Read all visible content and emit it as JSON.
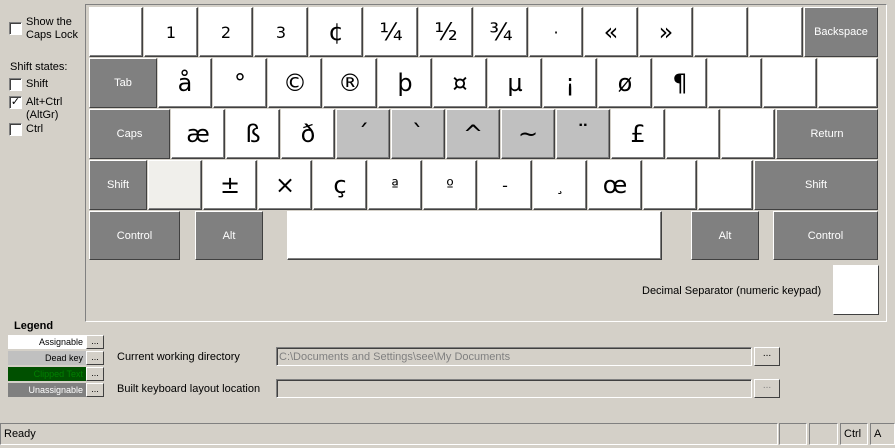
{
  "options": {
    "show_caps_lock": {
      "label": "Show the Caps Lock",
      "checked": false
    },
    "shift_states_title": "Shift states:",
    "shift": {
      "label": "Shift",
      "checked": false
    },
    "altgr": {
      "label": "Alt+Ctrl (AltGr)",
      "checked": true
    },
    "ctrl": {
      "label": "Ctrl",
      "checked": false
    }
  },
  "keyboard": {
    "row1": [
      "",
      "1",
      "2",
      "3",
      "¢",
      "¼",
      "½",
      "¾",
      "·",
      "«",
      "»",
      "",
      "",
      "Backspace"
    ],
    "row2": [
      "Tab",
      "å",
      "°",
      "©",
      "®",
      "þ",
      "¤",
      "µ",
      "¡",
      "ø",
      "¶",
      "",
      "",
      ""
    ],
    "row3": [
      "Caps",
      "æ",
      "ß",
      "ð",
      "´",
      "`",
      "^",
      "~",
      "¨",
      "£",
      "",
      "",
      "Return"
    ],
    "row4": [
      "Shift",
      "",
      "±",
      "×",
      "ç",
      "ª",
      "º",
      "-",
      "¸",
      "œ",
      "",
      "",
      "Shift"
    ],
    "row5": [
      "Control",
      "Alt",
      "",
      "Alt",
      "Control"
    ],
    "decimal_separator_label": "Decimal Separator (numeric keypad)",
    "decimal_separator_value": ""
  },
  "legend": {
    "title": "Legend",
    "items": [
      {
        "label": "Assignable",
        "color": "#ffffff",
        "text_color": "#000000"
      },
      {
        "label": "Dead key",
        "color": "#c0c0c0",
        "text_color": "#000000"
      },
      {
        "label": "Clipped Text",
        "color": "#005000",
        "text_color": "#008000"
      },
      {
        "label": "Unassignable",
        "color": "#808080",
        "text_color": "#ffffff"
      }
    ],
    "button_label": "..."
  },
  "paths": {
    "cwd_label": "Current working directory",
    "cwd_value": "C:\\Documents and Settings\\see\\My Documents",
    "build_label": "Built keyboard layout location",
    "build_value": "",
    "browse_label": "..."
  },
  "statusbar": {
    "ready": "Ready",
    "ctrl": "Ctrl",
    "a": "A"
  }
}
